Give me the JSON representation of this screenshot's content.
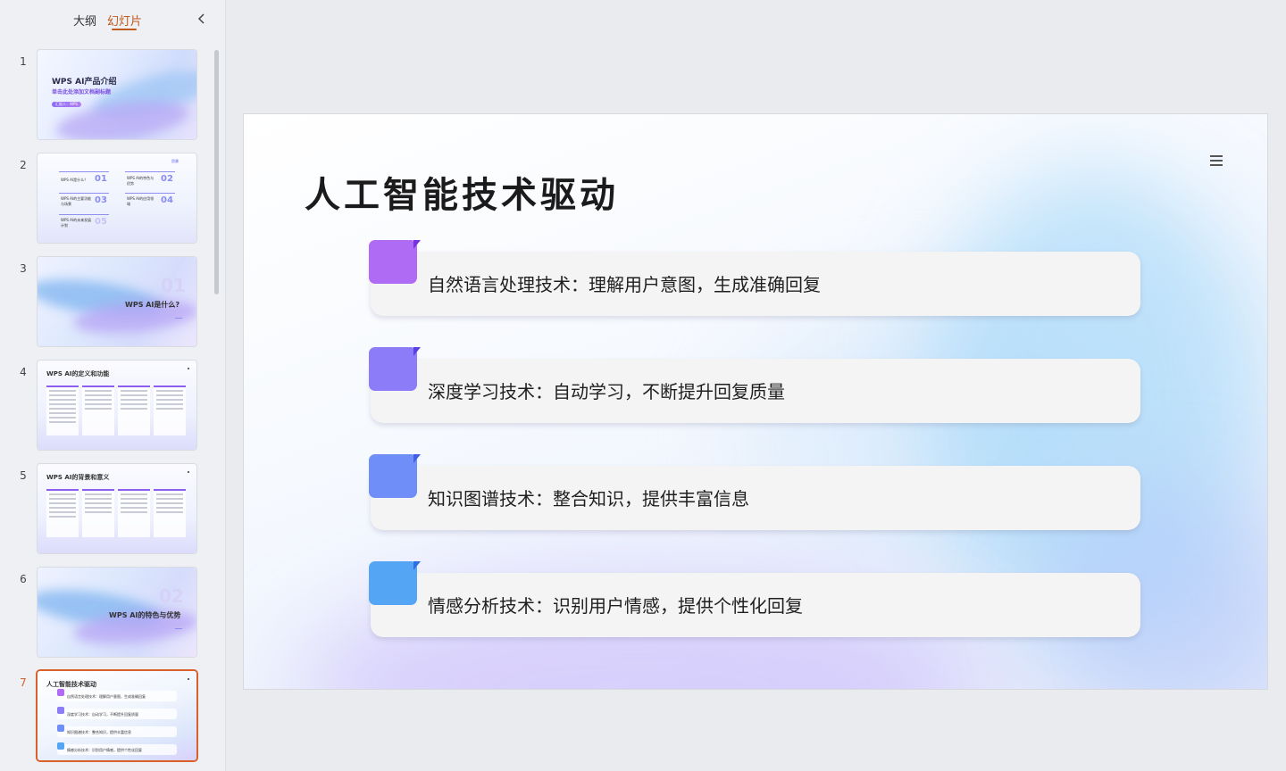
{
  "panel": {
    "tabs": [
      {
        "label": "大纲"
      },
      {
        "label": "幻灯片"
      }
    ]
  },
  "thumbnails": [
    {
      "number": "1",
      "title": "WPS AI产品介绍",
      "subtitle": "单击此处添加文档副标题",
      "pill": "汇报人：WPS"
    },
    {
      "number": "2",
      "label": "目录",
      "entries": [
        {
          "text": "WPS AI是什么？",
          "num": "01"
        },
        {
          "text": "WPS AI的特色与优势",
          "num": "02"
        },
        {
          "text": "WPS AI的主要功能与场景",
          "num": "03"
        },
        {
          "text": "WPS AI的应用领域",
          "num": "04"
        },
        {
          "text": "WPS AI的未来发展计划",
          "num": "05"
        }
      ]
    },
    {
      "number": "3",
      "big": "01",
      "title": "WPS AI是什么?"
    },
    {
      "number": "4",
      "title": "WPS AI的定义和功能"
    },
    {
      "number": "5",
      "title": "WPS AI的背景和意义"
    },
    {
      "number": "6",
      "big": "02",
      "title": "WPS AI的特色与优势"
    },
    {
      "number": "7",
      "title": "人工智能技术驱动"
    }
  ],
  "slide": {
    "title": "人工智能技术驱动",
    "items": [
      {
        "text": "自然语言处理技术：理解用户意图，生成准确回复",
        "color": "#b06bf5",
        "dark": "#7a2fe0"
      },
      {
        "text": "深度学习技术：自动学习，不断提升回复质量",
        "color": "#8c7cf7",
        "dark": "#5a3fe6"
      },
      {
        "text": "知识图谱技术：整合知识，提供丰富信息",
        "color": "#6f8ef7",
        "dark": "#3f5fe8"
      },
      {
        "text": "情感分析技术：识别用户情感，提供个性化回复",
        "color": "#55a5f5",
        "dark": "#2f6fe6"
      }
    ]
  }
}
